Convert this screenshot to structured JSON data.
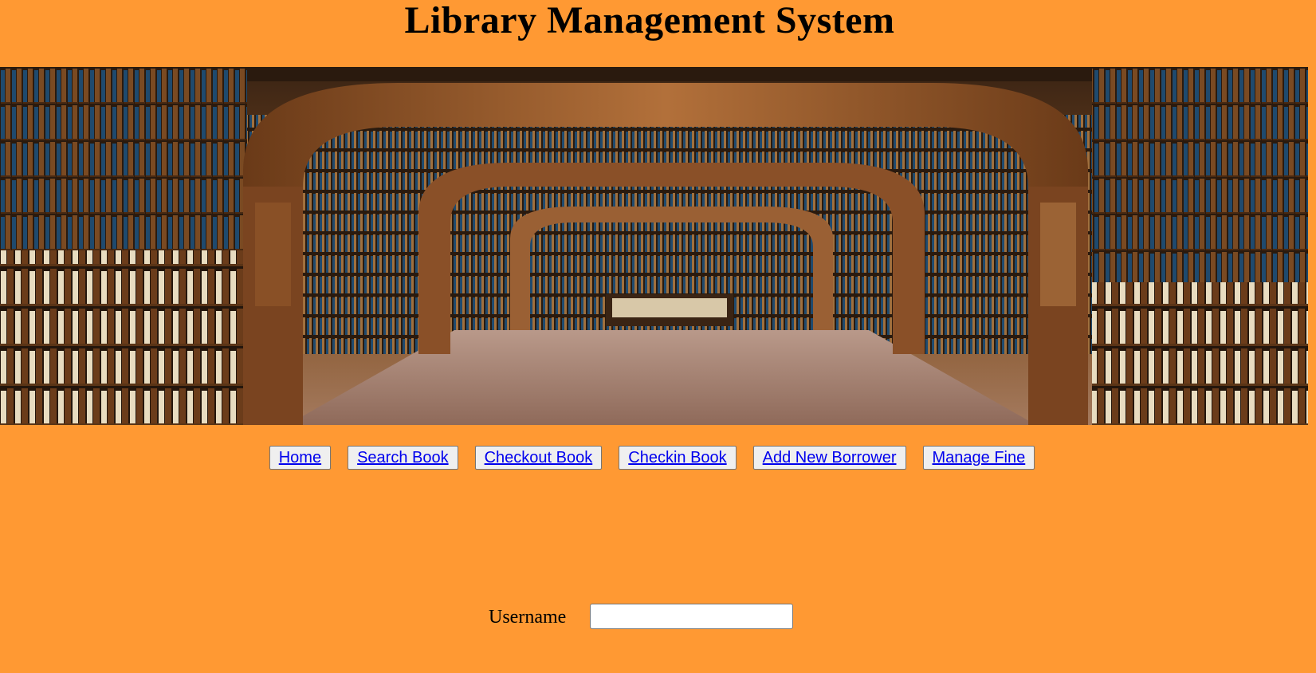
{
  "header": {
    "title": "Library Management System"
  },
  "banner": {
    "image_subject": "library-interior-bookshelves-arches"
  },
  "nav": {
    "items": [
      {
        "label": "Home"
      },
      {
        "label": "Search Book"
      },
      {
        "label": "Checkout Book"
      },
      {
        "label": "Checkin Book"
      },
      {
        "label": "Add New Borrower"
      },
      {
        "label": "Manage Fine"
      }
    ]
  },
  "login": {
    "username_label": "Username",
    "username_value": "",
    "username_placeholder": ""
  },
  "colors": {
    "background": "#FF9933",
    "link": "#0000EE",
    "button_bg": "#EFEFEF"
  }
}
